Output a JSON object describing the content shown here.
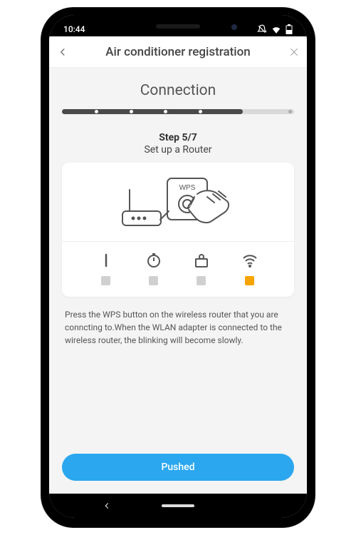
{
  "status": {
    "time": "10:44"
  },
  "appbar": {
    "title": "Air conditioner registration"
  },
  "section": {
    "title": "Connection"
  },
  "progress": {
    "current": 5,
    "total": 7,
    "fill_percent": 78
  },
  "step": {
    "label": "Step 5/7",
    "subtitle": "Set up a Router",
    "wps_label": "WPS"
  },
  "indicators": [
    {
      "icon": "line-icon",
      "active": false
    },
    {
      "icon": "timer-icon",
      "active": false
    },
    {
      "icon": "device-icon",
      "active": false
    },
    {
      "icon": "wifi-icon",
      "active": true
    }
  ],
  "instructions_text": "Press the WPS button on the wireless router that you are conncting to.When the WLAN adapter is connected to the wireless router, the blinking will become slowly.",
  "button": {
    "pushed_label": "Pushed"
  }
}
